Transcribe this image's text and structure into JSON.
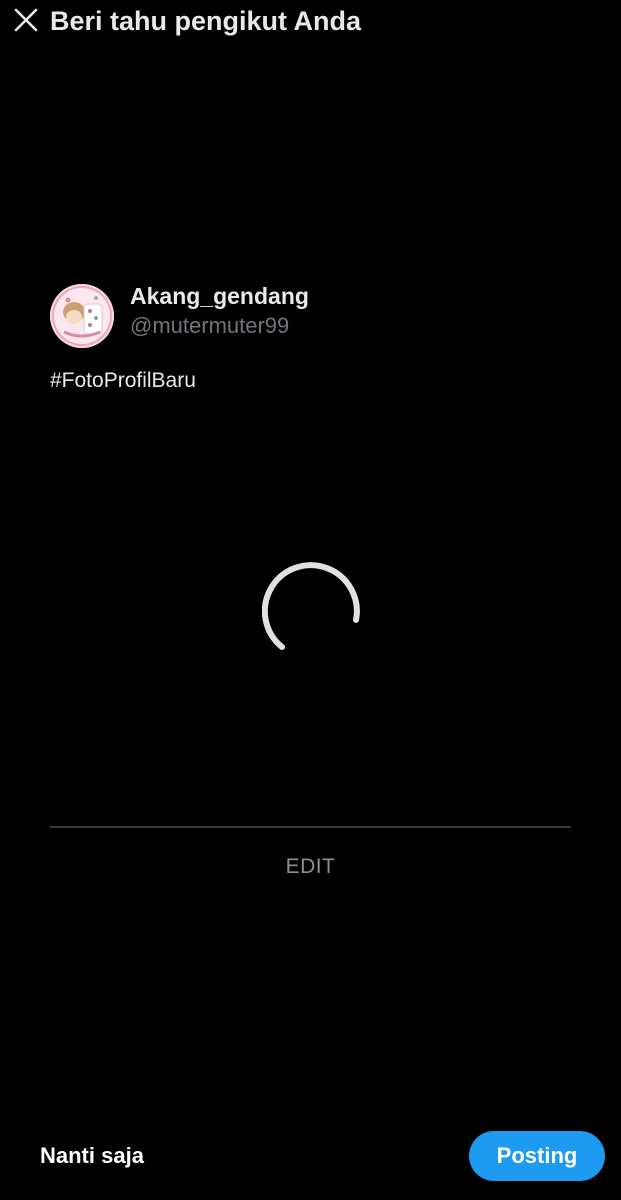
{
  "header": {
    "close_icon": "close-icon",
    "title": "Beri tahu pengikut Anda"
  },
  "profile": {
    "display_name": "Akang_gendang",
    "handle": "@mutermuter99",
    "avatar_icon": "avatar"
  },
  "post": {
    "text": "#FotoProfilBaru"
  },
  "media": {
    "loading_icon": "loading-spinner-icon"
  },
  "actions": {
    "edit_label": "EDIT",
    "later_label": "Nanti saja",
    "post_label": "Posting"
  },
  "colors": {
    "background": "#000000",
    "primary_text": "#e7e9ea",
    "secondary_text": "#71767b",
    "accent": "#1d9bf0",
    "divider": "#3a3d40"
  }
}
